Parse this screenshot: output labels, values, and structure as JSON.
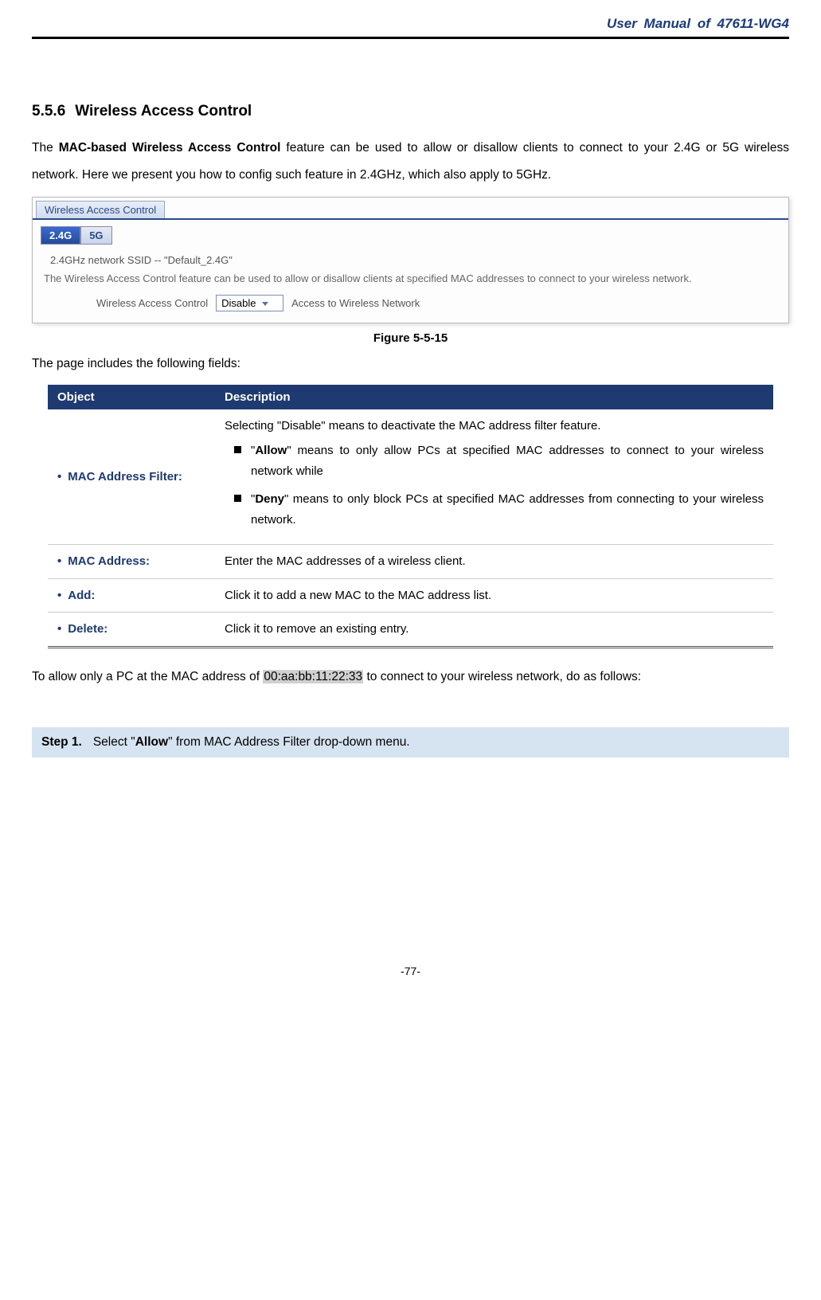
{
  "header": {
    "title": "User Manual of 47611-WG4"
  },
  "section": {
    "number": "5.5.6",
    "title": "Wireless Access Control"
  },
  "intro": {
    "p1_a": "The ",
    "p1_b": "MAC-based Wireless Access Control",
    "p1_c": " feature can be used to allow or disallow clients to connect to your 2.4G or 5G wireless network. Here we present you how to config such feature in 2.4GHz, which also apply to 5GHz."
  },
  "screenshot": {
    "tab": "Wireless Access Control",
    "band24": "2.4G",
    "band5": "5G",
    "ssid_line": "2.4GHz network SSID -- \"Default_2.4G\"",
    "desc": "The Wireless Access Control feature can be used to allow or disallow clients at specified MAC addresses to connect to your wireless network.",
    "control_label": "Wireless Access Control",
    "select_value": "Disable",
    "after_text": "Access to Wireless Network"
  },
  "figure_caption": "Figure 5-5-15",
  "lead_in": "The page includes the following fields:",
  "table": {
    "h_object": "Object",
    "h_desc": "Description",
    "rows": [
      {
        "object": "MAC Address Filter:",
        "desc_intro": "Selecting \"Disable\" means to deactivate the MAC address filter feature.",
        "bullets": [
          {
            "q1": "\"",
            "bold": "Allow",
            "rest": "\" means to only allow PCs at specified MAC addresses to connect to your wireless network while"
          },
          {
            "q1": "\"",
            "bold": "Deny",
            "rest": "\" means to only block PCs at specified MAC addresses from connecting to your wireless network."
          }
        ]
      },
      {
        "object": "MAC Address:",
        "desc": "Enter the MAC addresses of a wireless client."
      },
      {
        "object": "Add:",
        "desc": "Click it to add a new MAC to the MAC address list."
      },
      {
        "object": "Delete:",
        "desc": "Click it to remove an existing entry."
      }
    ]
  },
  "example": {
    "pre": "To allow only a PC at the MAC address of ",
    "mac": "00:aa:bb:11:22:33",
    "post": " to connect to your wireless network, do as follows:"
  },
  "step1": {
    "label": "Step 1.",
    "pre": "Select \"",
    "bold": "Allow",
    "post": "\" from MAC Address Filter drop-down menu."
  },
  "page_number": "-77-"
}
